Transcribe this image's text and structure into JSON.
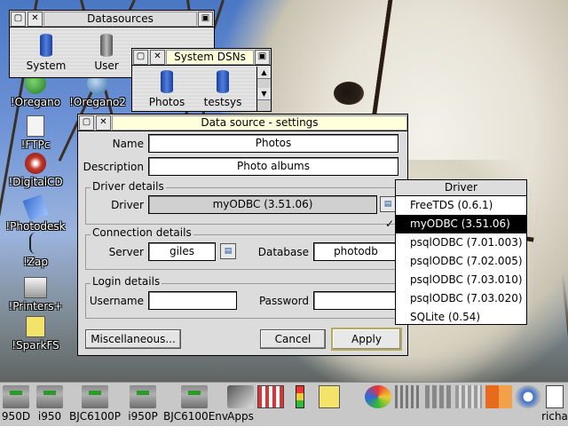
{
  "windows": {
    "datasources": {
      "title": "Datasources",
      "icons": [
        {
          "label": "System"
        },
        {
          "label": "User"
        }
      ]
    },
    "system_dsns": {
      "title": "System DSNs",
      "icons": [
        {
          "label": "Photos"
        },
        {
          "label": "testsys"
        }
      ]
    },
    "settings": {
      "title": "Data source - settings",
      "name_label": "Name",
      "name_value": "Photos",
      "description_label": "Description",
      "description_value": "Photo albums",
      "driver_group": "Driver details",
      "driver_label": "Driver",
      "driver_value": "myODBC (3.51.06)",
      "connection_group": "Connection details",
      "server_label": "Server",
      "server_value": "giles",
      "database_label": "Database",
      "database_value": "photodb",
      "login_group": "Login details",
      "username_label": "Username",
      "username_value": "",
      "password_label": "Password",
      "password_value": "",
      "misc_button": "Miscellaneous...",
      "cancel_button": "Cancel",
      "apply_button": "Apply"
    }
  },
  "driver_menu": {
    "title": "Driver",
    "items": [
      {
        "label": "FreeTDS (0.6.1)",
        "selected": false
      },
      {
        "label": "myODBC (3.51.06)",
        "selected": true
      },
      {
        "label": "psqlODBC (7.01.003)",
        "selected": false
      },
      {
        "label": "psqlODBC (7.02.005)",
        "selected": false
      },
      {
        "label": "psqlODBC (7.03.010)",
        "selected": false
      },
      {
        "label": "psqlODBC (7.03.020)",
        "selected": false
      },
      {
        "label": "SQLite (0.54)",
        "selected": false
      }
    ],
    "tick": "✓"
  },
  "desktop_icons": [
    {
      "label": "!Oregano",
      "icon": "globe-icon"
    },
    {
      "label": "!Oregano2",
      "icon": "globe-icon"
    },
    {
      "label": "!FTPc",
      "icon": "document-icon"
    },
    {
      "label": "!DigitalCD",
      "icon": "cd-player-icon"
    },
    {
      "label": "!Photodesk",
      "icon": "photodesk-icon"
    },
    {
      "label": "!Zap",
      "icon": "zap-icon"
    },
    {
      "label": "!Printers+",
      "icon": "printer-icon"
    },
    {
      "label": "!SparkFS",
      "icon": "sparkfs-icon"
    }
  ],
  "iconbar": {
    "items": [
      {
        "label": "950D"
      },
      {
        "label": "i950"
      },
      {
        "label": "BJC6100P"
      },
      {
        "label": "i950P"
      },
      {
        "label": "BJC6100Env"
      },
      {
        "label": "Apps"
      },
      {
        "label": "richa"
      }
    ]
  },
  "colors": {
    "menu_selected_bg": "#000000",
    "menu_selected_fg": "#ffffff",
    "window_bg": "#dcdcdc",
    "default_button_border": "#b8a858"
  }
}
